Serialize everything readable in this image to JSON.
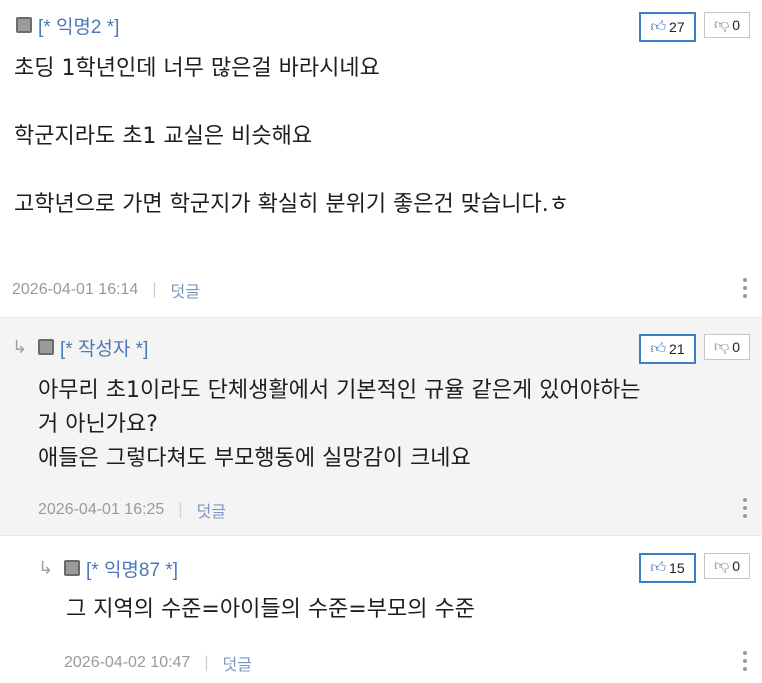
{
  "comments": [
    {
      "author": "[* 익명2 *]",
      "likes": "27",
      "dislikes": "0",
      "body": "초딩 1학년인데 너무 많은걸 바라시네요\n\n학군지라도 초1 교실은 비슷해요\n\n고학년으로 가면 학군지가 확실히 분위기 좋은건 맞습니다.ㅎ",
      "timestamp": "2026-04-01 16:14",
      "reply_label": "덧글"
    },
    {
      "author": "[* 작성자 *]",
      "likes": "21",
      "dislikes": "0",
      "body": "아무리 초1이라도 단체생활에서 기본적인 규율 같은게 있어야하는\n거 아닌가요?\n애들은 그렇다쳐도 부모행동에 실망감이 크네요",
      "timestamp": "2026-04-01 16:25",
      "reply_label": "덧글"
    },
    {
      "author": "[* 익명87 *]",
      "likes": "15",
      "dislikes": "0",
      "body": "그 지역의 수준=아이들의 수준=부모의 수준",
      "timestamp": "2026-04-02 10:47",
      "reply_label": "덧글"
    }
  ],
  "colors": {
    "author": "#4a78b9",
    "like_border": "#3a7fc4",
    "reply_bg": "#f4f4f4"
  },
  "icons": {
    "like": "thumbs-up-icon",
    "dislike": "thumbs-down-icon",
    "reply": "reply-arrow-icon",
    "more": "more-vertical-icon"
  }
}
